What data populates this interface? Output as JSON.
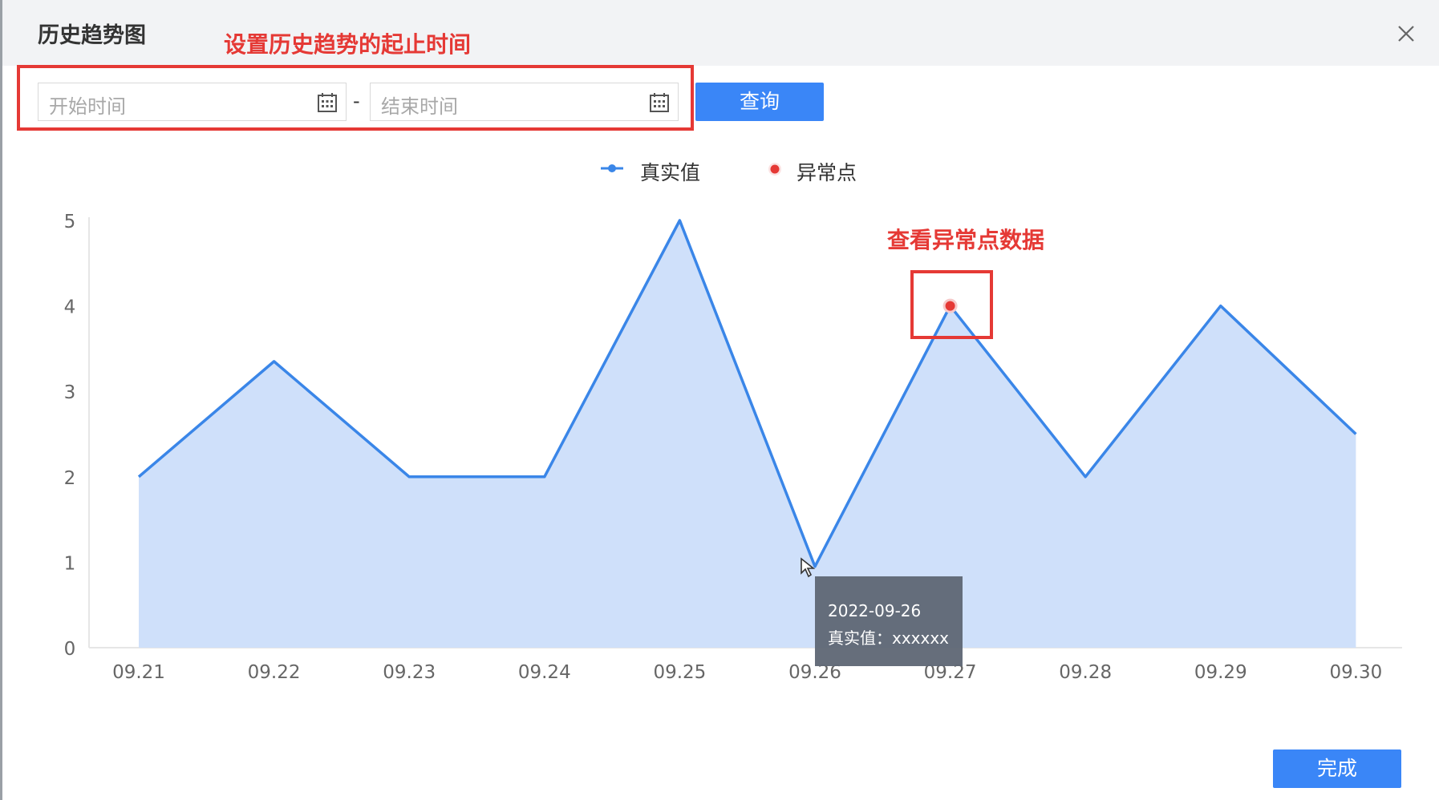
{
  "dialog": {
    "title": "历史趋势图",
    "annotation_time": "设置历史趋势的起止时间",
    "annotation_anomaly": "查看异常点数据"
  },
  "filters": {
    "start_placeholder": "开始时间",
    "separator": "-",
    "end_placeholder": "结束时间",
    "query_label": "查询"
  },
  "legend": {
    "real_value": "真实值",
    "anomaly": "异常点"
  },
  "tooltip": {
    "date": "2022-09-26",
    "value_line": "真实值：xxxxxx"
  },
  "footer": {
    "done_label": "完成"
  },
  "colors": {
    "line": "#3a86e8",
    "area": "#cfe0fa",
    "anomaly": "#e53935",
    "button": "#3a86f7"
  },
  "icons": {
    "close": "close-icon",
    "calendar": "calendar-icon"
  },
  "chart_data": {
    "type": "area",
    "categories": [
      "09.21",
      "09.22",
      "09.23",
      "09.24",
      "09.25",
      "09.26",
      "09.27",
      "09.28",
      "09.29",
      "09.30"
    ],
    "series": [
      {
        "name": "真实值",
        "values": [
          2,
          3.35,
          2,
          2,
          5,
          0.95,
          4,
          2,
          4,
          2.5
        ]
      }
    ],
    "anomalies": [
      {
        "x": "09.27",
        "y": 4
      }
    ],
    "yticks": [
      "0",
      "1",
      "2",
      "3",
      "4",
      "5"
    ],
    "ylim": [
      0,
      5
    ],
    "grid": false,
    "legend_position": "top-center"
  }
}
